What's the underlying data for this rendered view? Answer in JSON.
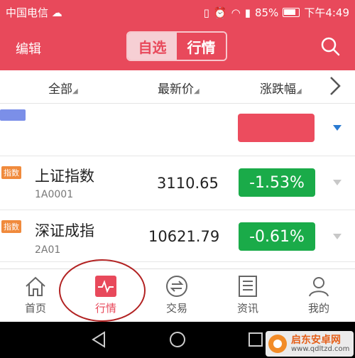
{
  "status_bar": {
    "carrier": "中国电信",
    "battery": "85%",
    "time": "下午4:49"
  },
  "header": {
    "edit_label": "编辑",
    "tab_selected": "自选",
    "tab_market": "行情"
  },
  "columns": {
    "all": "全部",
    "latest_price": "最新价",
    "change_pct": "涨跌幅"
  },
  "colors": {
    "brand_red": "#e8495b",
    "up_green": "#1aab49",
    "badge_orange": "#f08a3c",
    "dropdown_blue": "#2a7ad1"
  },
  "rows": [
    {
      "badge": "指数",
      "name": "上证指数",
      "code": "1A0001",
      "price": "3110.65",
      "change": "-1.53%"
    },
    {
      "badge": "指数",
      "name": "深证成指",
      "code": "2A01",
      "price": "10621.79",
      "change": "-0.61%"
    }
  ],
  "tabbar": {
    "home": "首页",
    "market": "行情",
    "trade": "交易",
    "news": "资讯",
    "mine": "我的"
  },
  "watermark": {
    "name": "启东安卓网",
    "url": "www.qdltzd.com"
  }
}
